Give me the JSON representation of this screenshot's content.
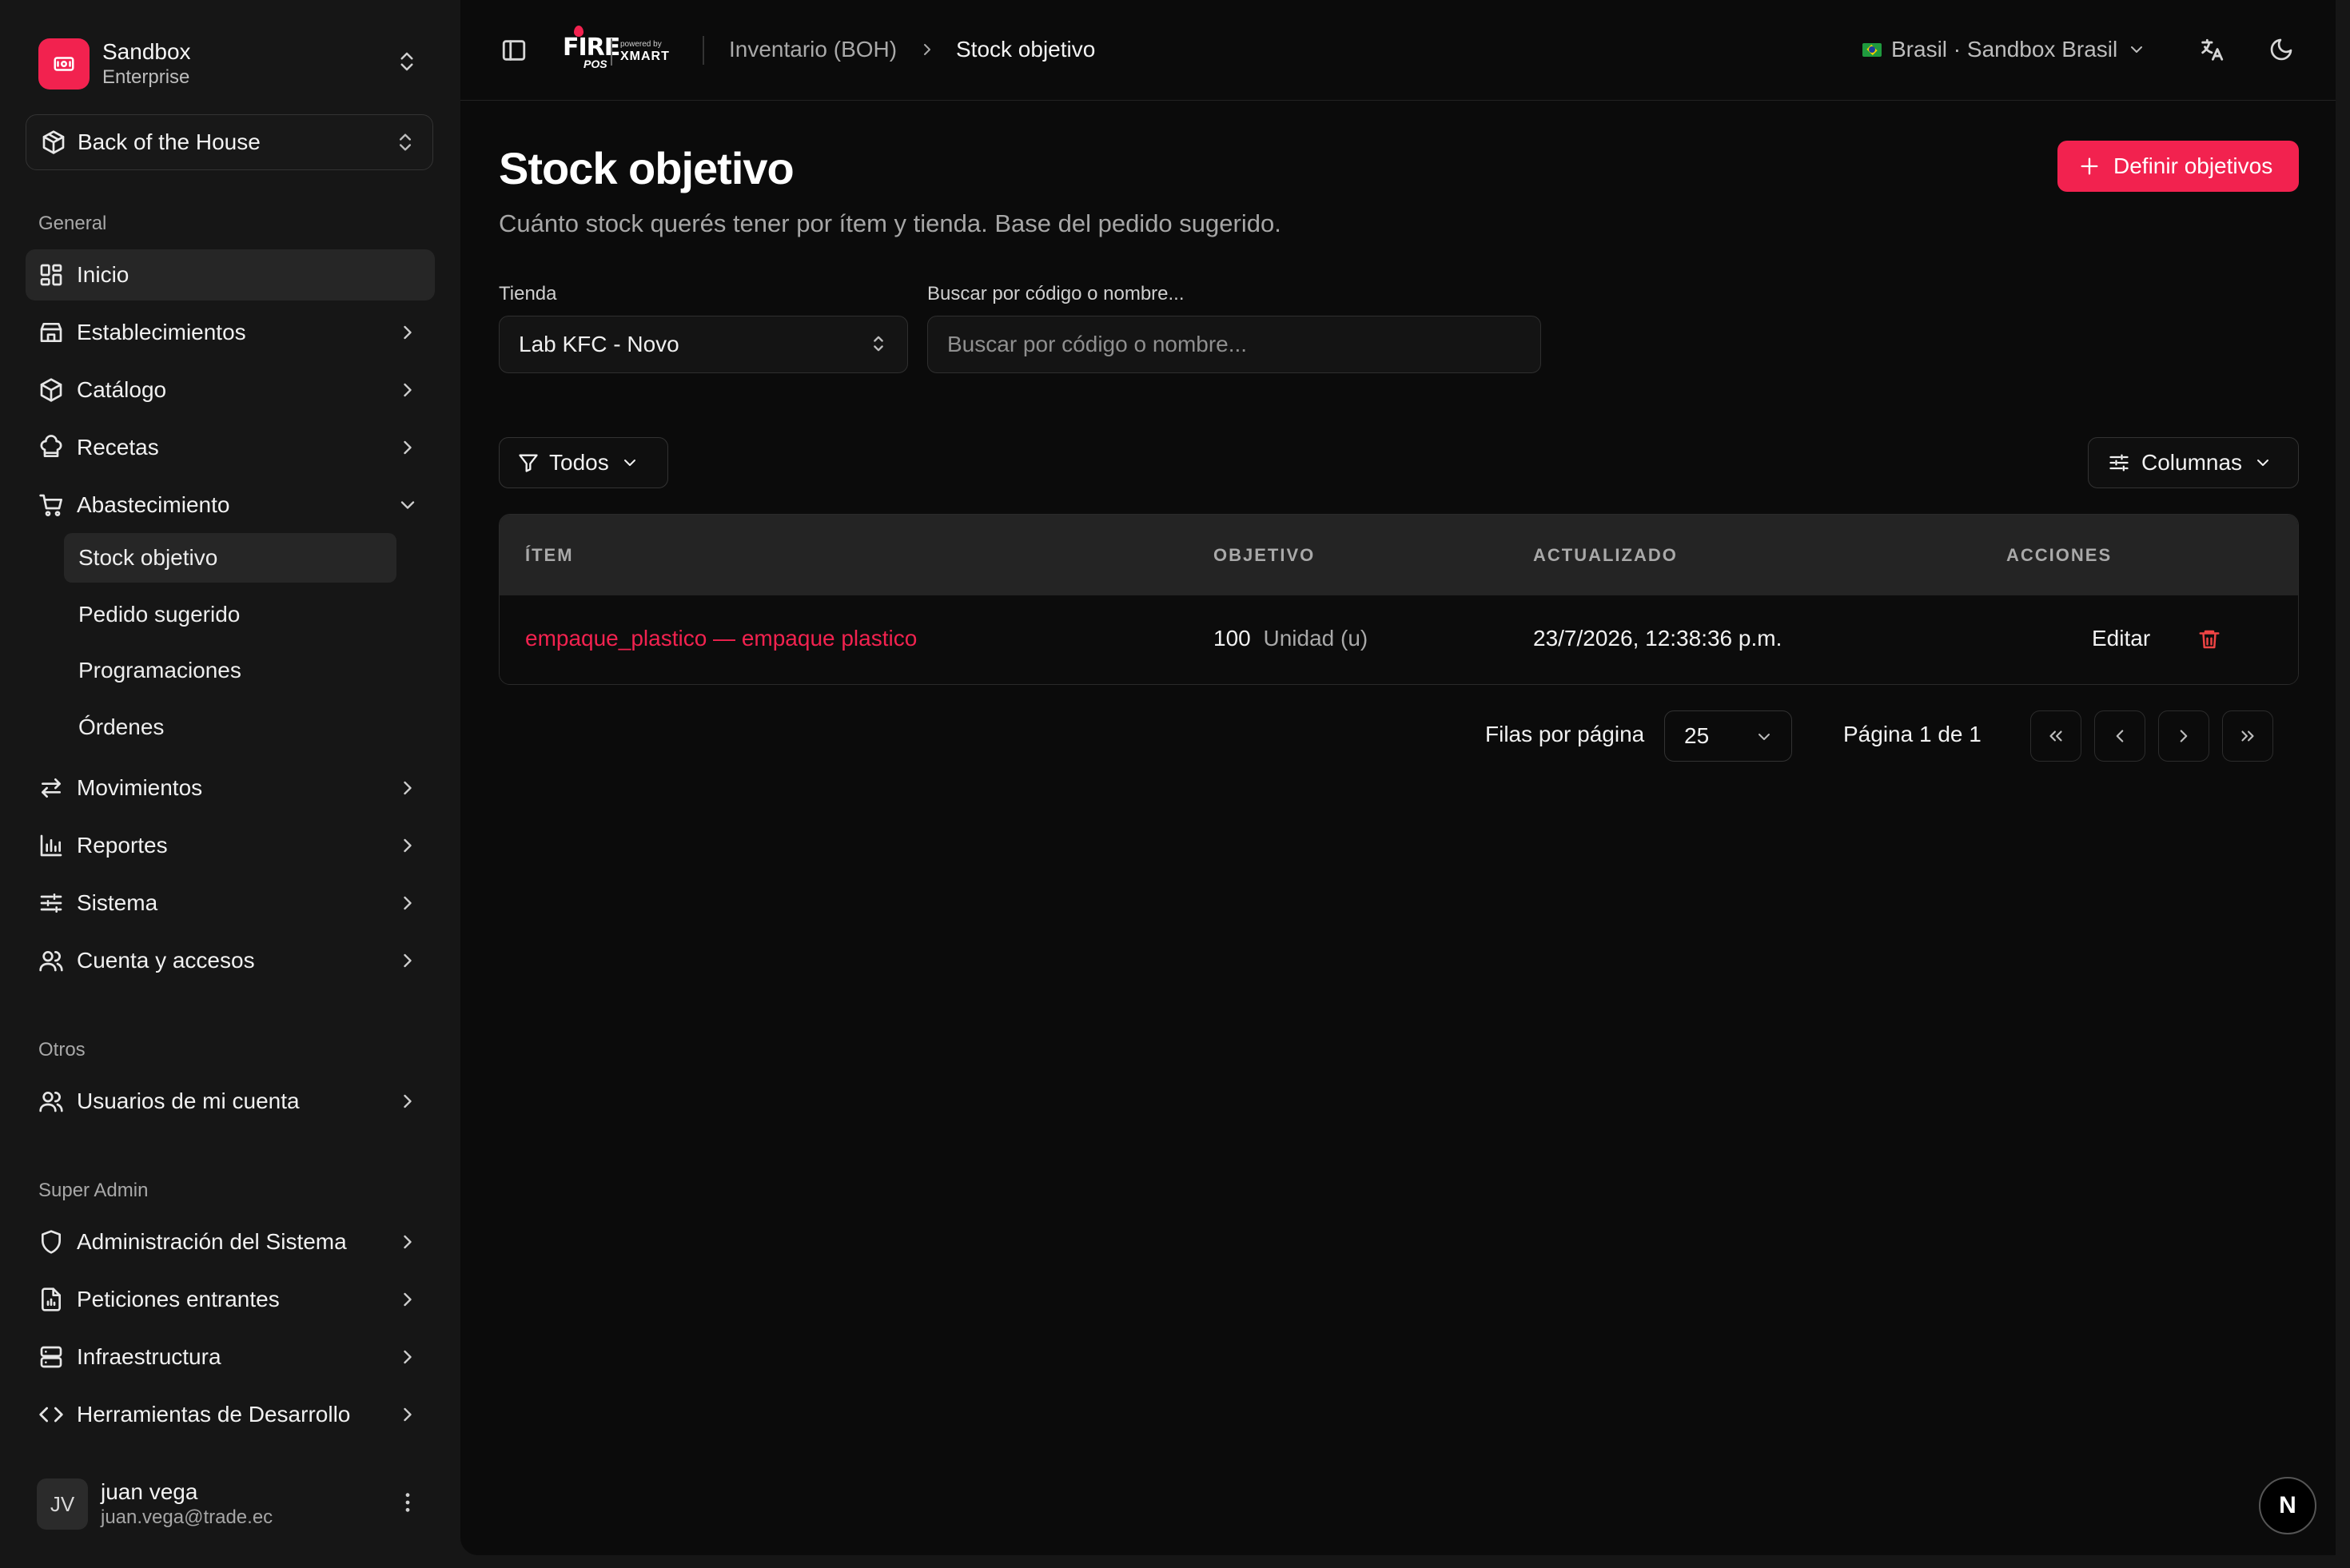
{
  "brand": {
    "name": "Sandbox",
    "plan": "Enterprise"
  },
  "workspace": {
    "label": "Back of the House"
  },
  "sidebar": {
    "general_title": "General",
    "items": [
      {
        "label": "Inicio",
        "icon": "dashboard-icon"
      },
      {
        "label": "Establecimientos",
        "icon": "store-icon"
      },
      {
        "label": "Catálogo",
        "icon": "package-icon"
      },
      {
        "label": "Recetas",
        "icon": "chef-hat-icon"
      },
      {
        "label": "Abastecimiento",
        "icon": "cart-icon"
      },
      {
        "label": "Movimientos",
        "icon": "arrows-icon"
      },
      {
        "label": "Reportes",
        "icon": "chart-icon"
      },
      {
        "label": "Sistema",
        "icon": "sliders-icon"
      },
      {
        "label": "Cuenta y accesos",
        "icon": "users-icon"
      }
    ],
    "sub_items": [
      {
        "label": "Stock objetivo"
      },
      {
        "label": "Pedido sugerido"
      },
      {
        "label": "Programaciones"
      },
      {
        "label": "Órdenes"
      }
    ],
    "otros_title": "Otros",
    "otros_items": [
      {
        "label": "Usuarios de mi cuenta"
      }
    ],
    "admin_title": "Super Admin",
    "admin_items": [
      {
        "label": "Administración del Sistema"
      },
      {
        "label": "Peticiones entrantes"
      },
      {
        "label": "Infraestructura"
      },
      {
        "label": "Herramientas de Desarrollo"
      }
    ]
  },
  "user": {
    "initials": "JV",
    "name": "juan vega",
    "email": "juan.vega@trade.ec"
  },
  "header": {
    "logo_word": "FIRE",
    "logo_sub": "POS",
    "powered_by": "powered by",
    "partner": "XMART",
    "breadcrumb": [
      "Inventario (BOH)",
      "Stock objetivo"
    ],
    "region": "Brasil · Sandbox Brasil"
  },
  "page": {
    "title": "Stock objetivo",
    "subtitle": "Cuánto stock querés tener por ítem y tienda. Base del pedido sugerido.",
    "primary_action": "Definir objetivos"
  },
  "filters": {
    "store_label": "Tienda",
    "store_value": "Lab KFC - Novo",
    "search_label": "Buscar por código o nombre...",
    "search_placeholder": "Buscar por código o nombre...",
    "filter_button": "Todos",
    "columns_button": "Columnas"
  },
  "table": {
    "headers": [
      "ÍTEM",
      "OBJETIVO",
      "ACTUALIZADO",
      "ACCIONES"
    ],
    "rows": [
      {
        "item": "empaque_plastico — empaque plastico",
        "objective": "100",
        "unit": "Unidad (u)",
        "updated": "23/7/2026, 12:38:36 p.m.",
        "edit_label": "Editar"
      }
    ]
  },
  "pagination": {
    "rows_label": "Filas por página",
    "rows_value": "25",
    "page_info": "Página 1 de 1"
  },
  "badge": "N",
  "colors": {
    "accent": "#f2224f",
    "background": "#0b0b0b",
    "sidebar": "#161616",
    "danger": "#ef4444"
  }
}
